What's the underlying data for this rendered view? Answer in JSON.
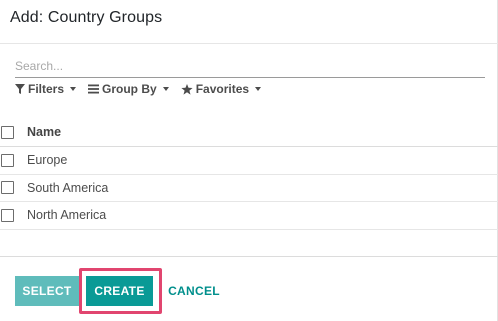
{
  "dialog": {
    "title": "Add: Country Groups"
  },
  "search": {
    "placeholder": "Search...",
    "value": ""
  },
  "filters": {
    "filters_label": "Filters",
    "group_by_label": "Group By",
    "favorites_label": "Favorites"
  },
  "table": {
    "column_name": "Name",
    "rows": [
      {
        "name": "Europe"
      },
      {
        "name": "South America"
      },
      {
        "name": "North America"
      }
    ]
  },
  "footer": {
    "select_label": "SELECT",
    "create_label": "CREATE",
    "cancel_label": "CANCEL"
  },
  "colors": {
    "primary": "#00a09d",
    "primary_disabled": "#5fbcbb",
    "highlight": "#e1456f"
  }
}
